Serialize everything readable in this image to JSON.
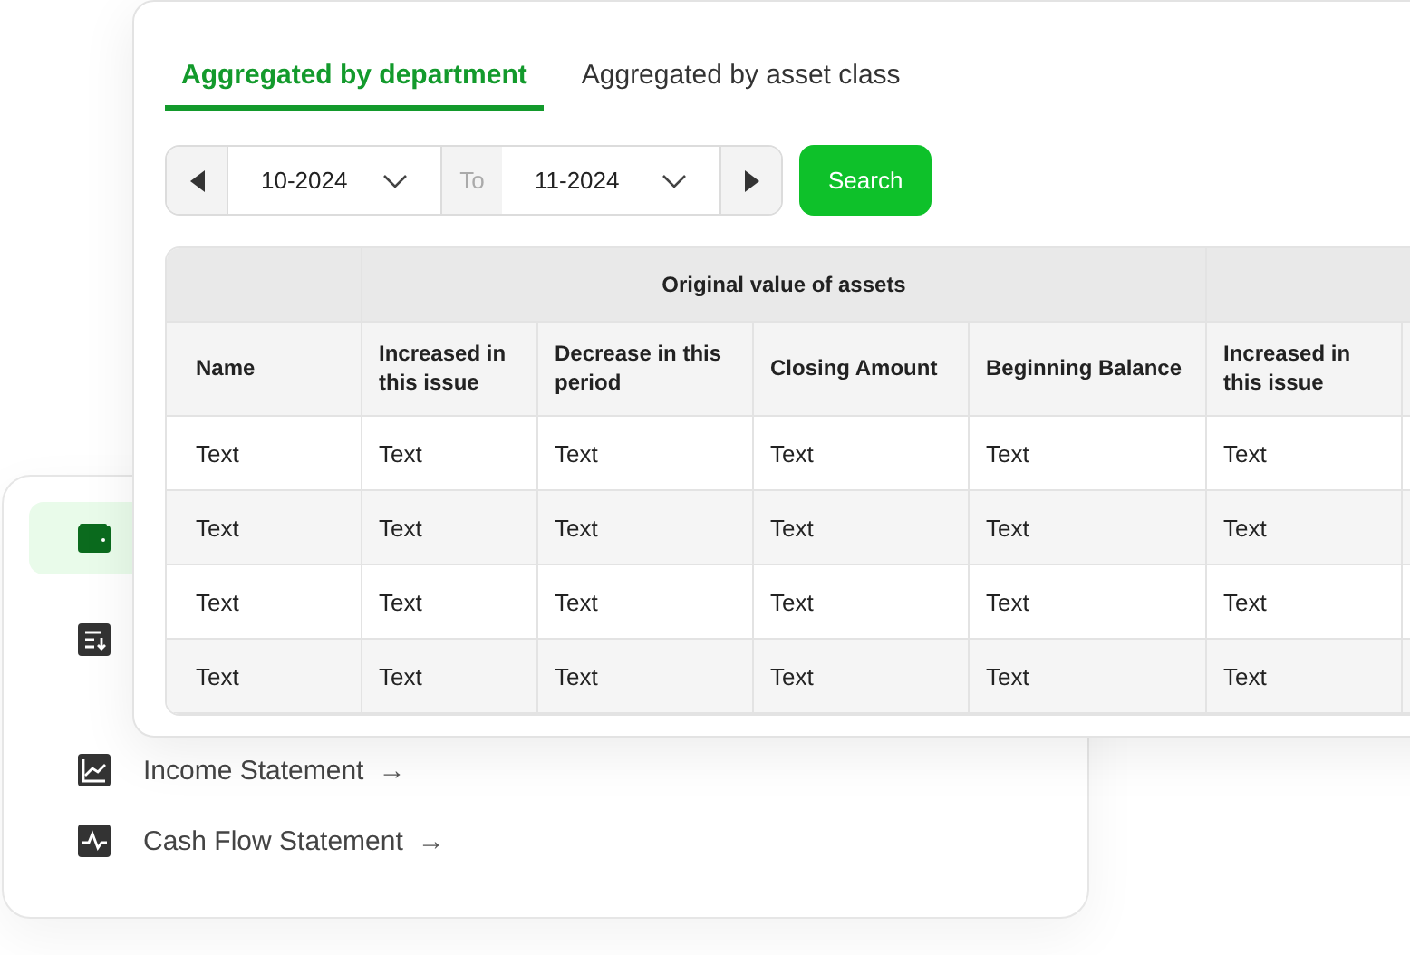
{
  "sidebar": {
    "items": [
      {
        "kind": "wallet",
        "selected": true
      },
      {
        "kind": "list",
        "selected": false
      },
      {
        "kind": "chart",
        "selected": false,
        "label": "Income Statement",
        "arrow": "→"
      },
      {
        "kind": "pulse",
        "selected": false,
        "label": "Cash Flow  Statement",
        "arrow": "→"
      }
    ]
  },
  "tabs": [
    {
      "label": "Aggregated by department",
      "selected": true
    },
    {
      "label": "Aggregated by asset class",
      "selected": false
    }
  ],
  "date_range": {
    "start": "10-2024",
    "separator": "To",
    "end": "11-2024"
  },
  "search_button": "Search",
  "table": {
    "first_column": "Name",
    "groups": [
      {
        "label": "Original value of assets",
        "columns": [
          "Increased in this issue",
          "Decrease in this period",
          "Closing Amount",
          "Beginning Balance"
        ]
      },
      {
        "columns": [
          "Increased in this issue"
        ]
      }
    ],
    "rows": [
      [
        "Text",
        "Text",
        "Text",
        "Text",
        "Text",
        "Text"
      ],
      [
        "Text",
        "Text",
        "Text",
        "Text",
        "Text",
        "Text"
      ],
      [
        "Text",
        "Text",
        "Text",
        "Text",
        "Text",
        "Text"
      ],
      [
        "Text",
        "Text",
        "Text",
        "Text",
        "Text",
        "Text"
      ]
    ]
  }
}
